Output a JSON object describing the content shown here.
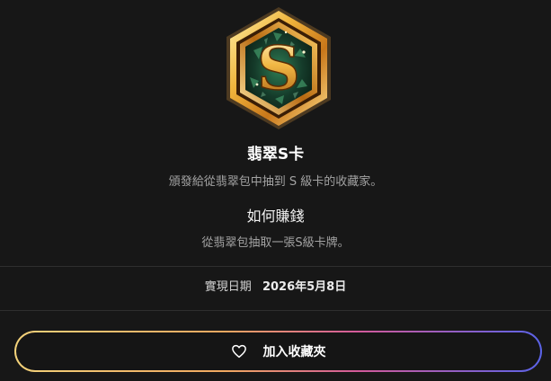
{
  "badge": {
    "letter": "S",
    "icon": "emerald-s-rank-hexagon-badge",
    "colors": {
      "gold": "#e8a93a",
      "emerald": "#1f5a3e"
    }
  },
  "card": {
    "title": "翡翠S卡",
    "description": "頒發給從翡翠包中抽到 S 級卡的收藏家。"
  },
  "how_to_earn": {
    "title": "如何賺錢",
    "description": "從翡翠包抽取一張S級卡牌。"
  },
  "realized": {
    "label": "實現日期",
    "date": "2026年5月8日"
  },
  "favorite_button": {
    "label": "加入收藏夾",
    "icon": "heart-icon",
    "gradient": [
      "#f3d27a",
      "#f0a860",
      "#d35a9a",
      "#5a63e8"
    ]
  }
}
